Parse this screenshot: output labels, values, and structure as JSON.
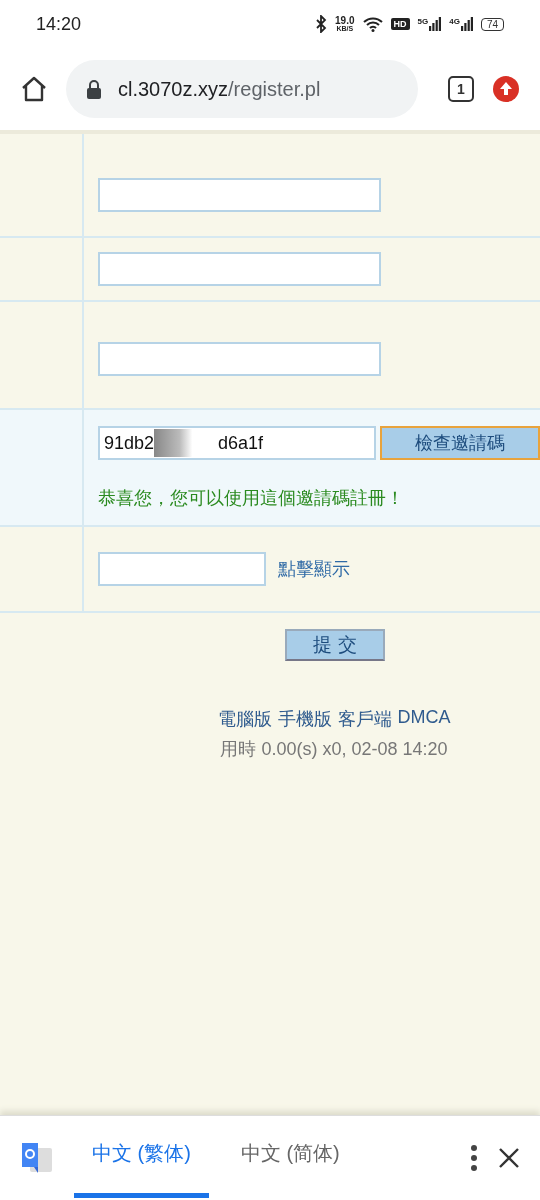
{
  "status_bar": {
    "time": "14:20",
    "speed": "19.0",
    "speed_unit": "KB/S",
    "hd": "HD",
    "net1": "5G",
    "net2": "4G",
    "battery": "74"
  },
  "browser": {
    "url_host": "cl.3070z.xyz",
    "url_path": "/register.pl",
    "tab_count": "1"
  },
  "form": {
    "rows": [
      {
        "kind": "input",
        "value": ""
      },
      {
        "kind": "input",
        "value": ""
      },
      {
        "kind": "input",
        "value": ""
      },
      {
        "kind": "invite",
        "value_start": "91db2",
        "value_end": "d6a1f",
        "button": "檢查邀請碼",
        "message": "恭喜您，您可以使用這個邀請碼註冊！"
      },
      {
        "kind": "captcha",
        "value": "",
        "link": "點擊顯示"
      }
    ],
    "submit": "提 交"
  },
  "footer": {
    "links": [
      "電腦版",
      "手機版",
      "客戶端",
      "DMCA"
    ],
    "info": "用時 0.00(s) x0, 02-08 14:20"
  },
  "translate_bar": {
    "tabs": [
      {
        "label": "中文 (繁体)",
        "selected": true
      },
      {
        "label": "中文 (简体)",
        "selected": false
      }
    ]
  }
}
